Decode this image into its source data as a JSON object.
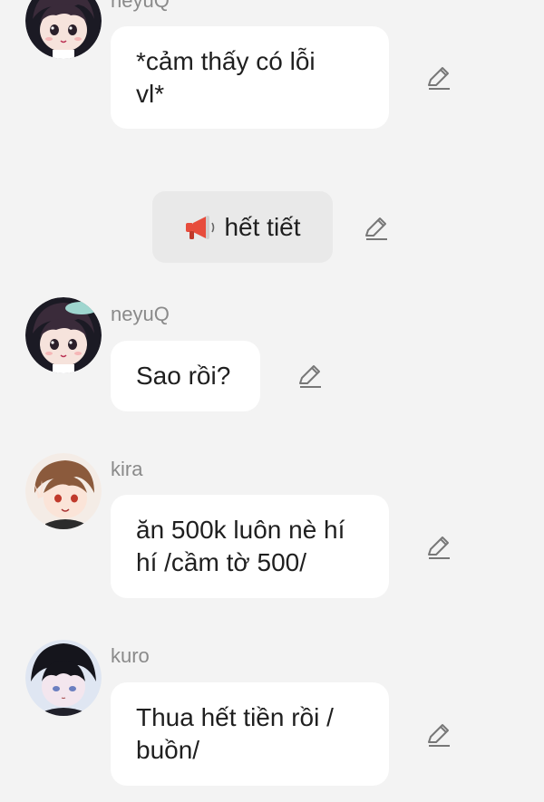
{
  "messages": [
    {
      "user": "neyuQ",
      "text": "*cảm thấy có lỗi\nvl*",
      "avatar": "anime-boy-teal-hat-avatar"
    },
    {
      "system": true,
      "icon": "megaphone-icon",
      "text": "hết tiết"
    },
    {
      "user": "neyuQ",
      "text": "Sao rồi?",
      "avatar": "anime-boy-teal-hat-avatar"
    },
    {
      "user": "kira",
      "text": "ăn 500k luôn nè hí\nhí /cầm tờ 500/",
      "avatar": "anime-boy-brown-hair-avatar"
    },
    {
      "user": "kuro",
      "text": "Thua hết tiền rồi /\nbuồn/",
      "avatar": "anime-boy-black-hair-avatar"
    }
  ],
  "colors": {
    "background": "#f3f3f3",
    "bubble": "#ffffff",
    "system_bubble": "#e9e9e9",
    "username": "#8a8a8a",
    "edit_icon": "#777777"
  }
}
